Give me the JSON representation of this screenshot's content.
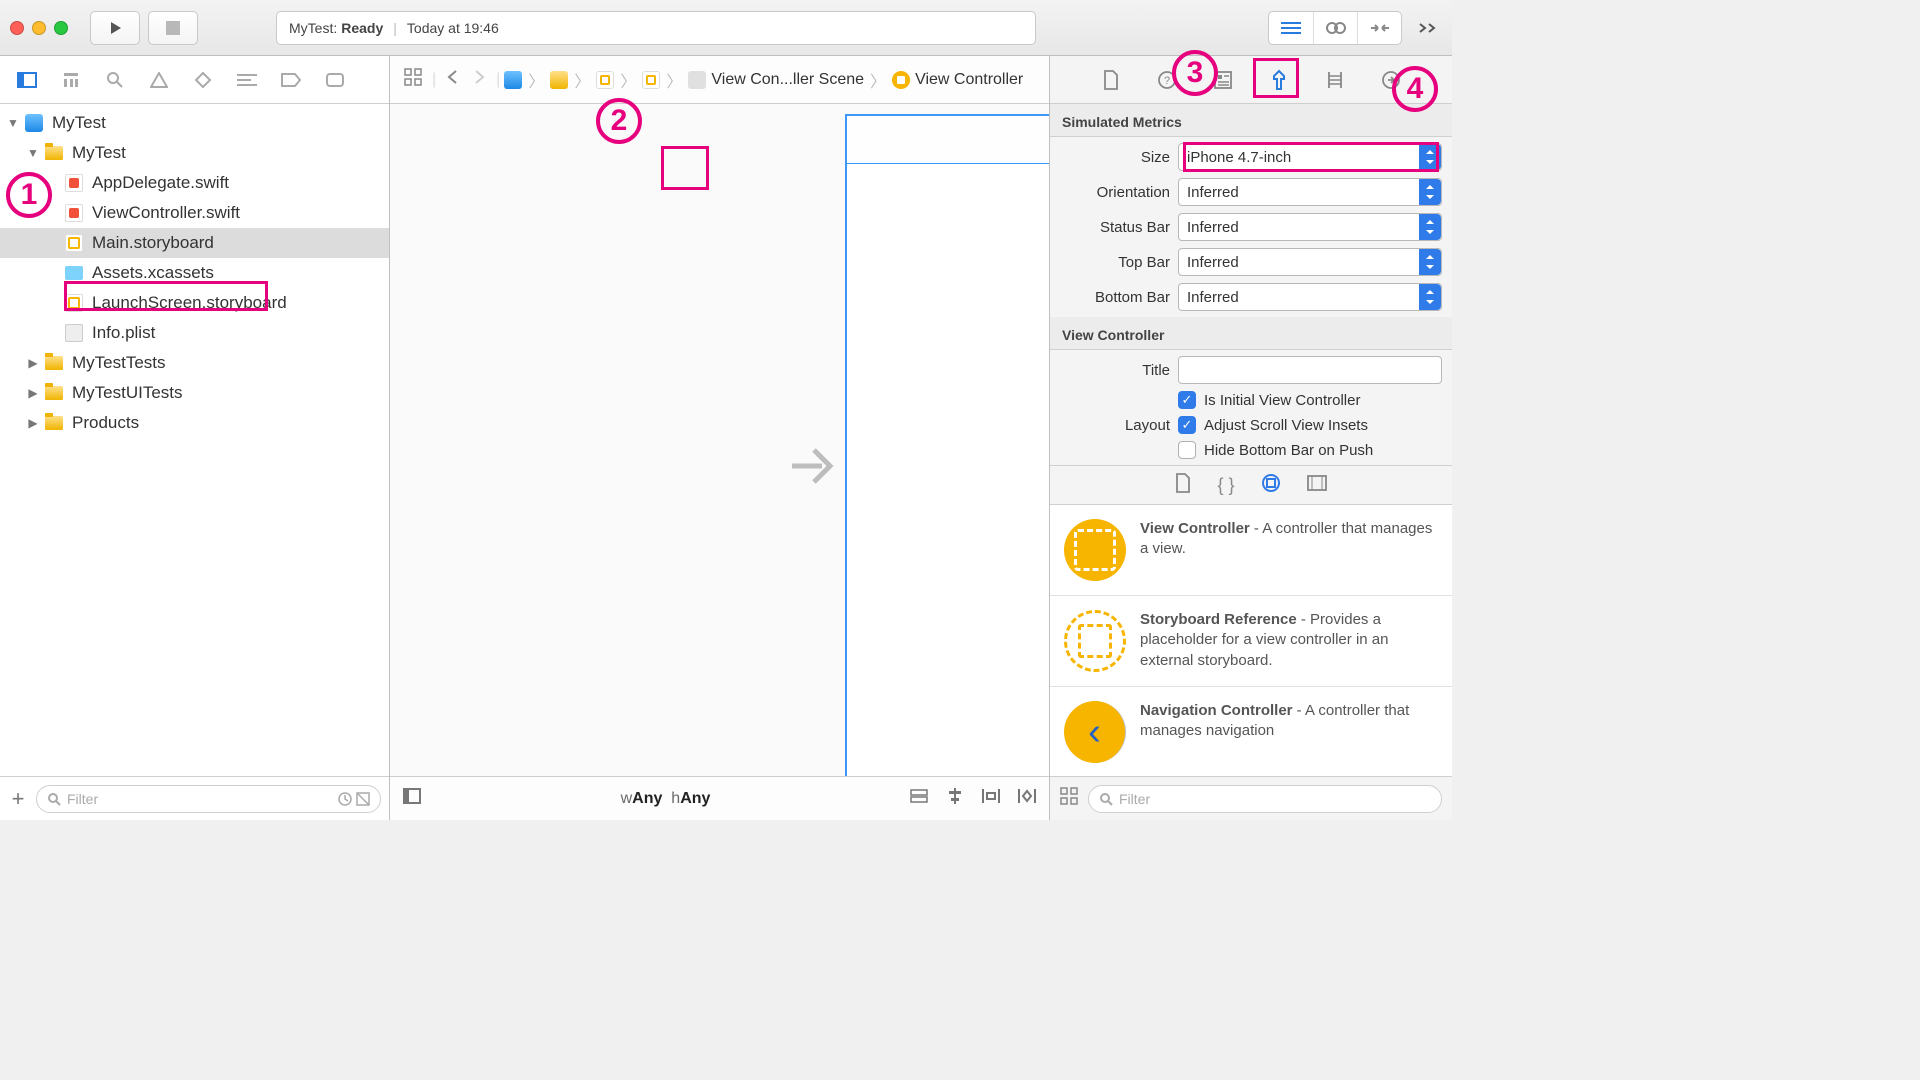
{
  "toolbar": {
    "status_project": "MyTest:",
    "status_state": "Ready",
    "status_time": "Today at 19:46"
  },
  "navigator": {
    "root": "MyTest",
    "group": "MyTest",
    "files": {
      "appdelegate": "AppDelegate.swift",
      "viewcontroller": "ViewController.swift",
      "mainsb": "Main.storyboard",
      "assets": "Assets.xcassets",
      "launch": "LaunchScreen.storyboard",
      "plist": "Info.plist"
    },
    "tests": "MyTestTests",
    "uitests": "MyTestUITests",
    "products": "Products",
    "filter_placeholder": "Filter"
  },
  "jumpbar": {
    "scene": "View Con...ller Scene",
    "vc": "View Controller"
  },
  "sizeclass": {
    "w_lbl": "w",
    "w_val": "Any",
    "h_lbl": "h",
    "h_val": "Any"
  },
  "inspector": {
    "sim_title": "Simulated Metrics",
    "size_lbl": "Size",
    "size_val": "iPhone 4.7-inch",
    "orient_lbl": "Orientation",
    "orient_val": "Inferred",
    "status_lbl": "Status Bar",
    "status_val": "Inferred",
    "topbar_lbl": "Top Bar",
    "topbar_val": "Inferred",
    "botbar_lbl": "Bottom Bar",
    "botbar_val": "Inferred",
    "vc_title": "View Controller",
    "title_lbl": "Title",
    "title_val": "",
    "initial_lbl": "Is Initial View Controller",
    "layout_lbl": "Layout",
    "adjust_lbl": "Adjust Scroll View Insets",
    "hide_lbl": "Hide Bottom Bar on Push"
  },
  "library": {
    "vc_title": "View Controller",
    "vc_desc": " - A controller that manages a view.",
    "ref_title": "Storyboard Reference",
    "ref_desc": " - Provides a placeholder for a view controller in an external storyboard.",
    "nav_title": "Navigation Controller",
    "nav_desc": " - A controller that manages navigation",
    "filter_placeholder": "Filter"
  },
  "annotations": {
    "a1": "1",
    "a2": "2",
    "a3": "3",
    "a4": "4"
  }
}
